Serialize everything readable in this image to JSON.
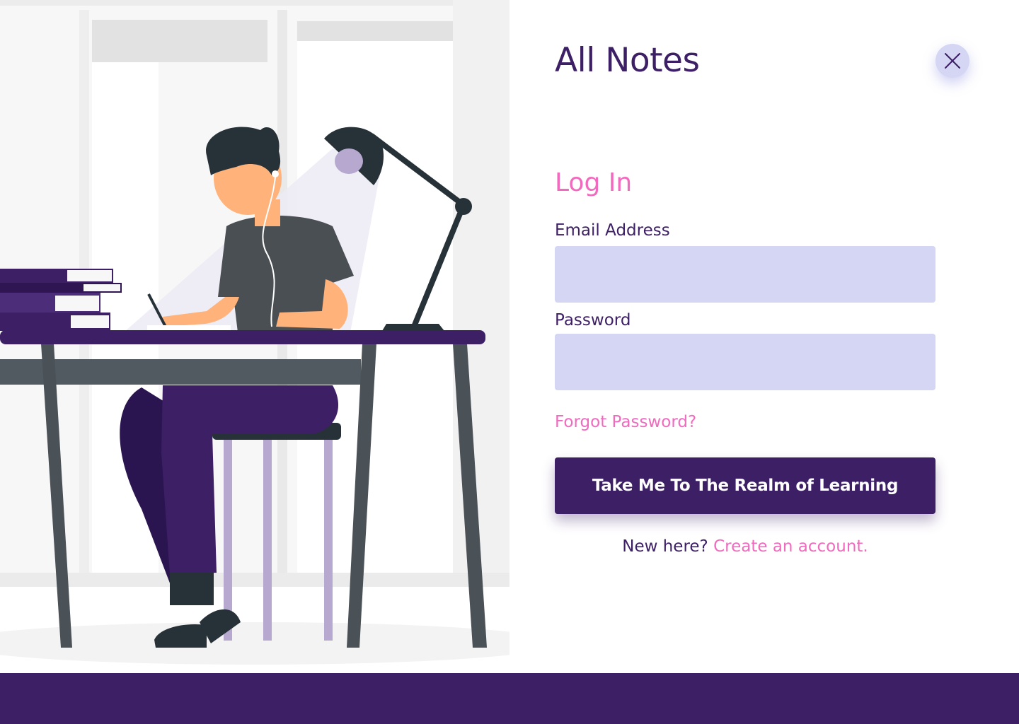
{
  "header": {
    "title": "All Notes",
    "close_icon": "close-icon"
  },
  "login": {
    "heading": "Log In",
    "email_label": "Email Address",
    "email_value": "",
    "email_placeholder": "",
    "password_label": "Password",
    "password_value": "",
    "password_placeholder": "",
    "forgot_password": "Forgot Password?",
    "submit_label": "Take Me To The Realm of Learning",
    "signup_prompt": "New here?",
    "signup_link": "Create an account."
  },
  "colors": {
    "brand_purple": "#3d1f66",
    "accent_pink": "#f06bbd",
    "input_fill": "#d4d6f4"
  }
}
